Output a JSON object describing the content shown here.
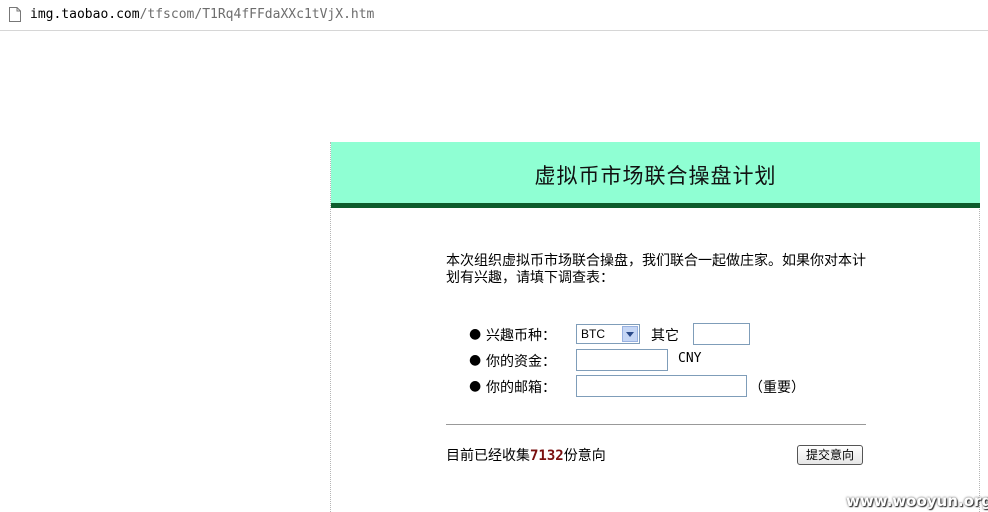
{
  "address_bar": {
    "url_host": "img.taobao.com",
    "url_path": "/tfscom/T1Rq4fFFdaXXc1tVjX.htm",
    "page_icon": "document-icon"
  },
  "page": {
    "title": "虚拟币市场联合操盘计划",
    "intro": "本次组织虚拟币市场联合操盘，我们联合一起做庄家。如果你对本计划有兴趣，请填下调查表：",
    "form": {
      "currency_label": "兴趣币种：",
      "currency_selected": "BTC",
      "other_label": "其它",
      "other_value": "",
      "funds_label": "你的资金：",
      "funds_value": "",
      "funds_unit": "CNY",
      "email_label": "你的邮箱：",
      "email_value": "",
      "email_note": "（重要）"
    },
    "footer": {
      "collected_prefix": "目前已经收集",
      "collected_count": "7132",
      "collected_suffix": "份意向",
      "submit_label": "提交意向"
    }
  },
  "watermark": "www.wooyun.org",
  "colors": {
    "header_bg": "#8fffd3",
    "header_border": "#0c5c2c",
    "count_color": "#7a1010"
  }
}
